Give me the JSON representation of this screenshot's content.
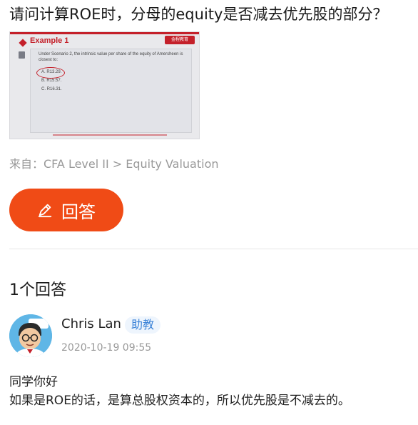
{
  "question": {
    "title": "请问计算ROE时，分母的equity是否减去优先股的部分？"
  },
  "thumbnail": {
    "heading": "Example 1",
    "logo_text": "金程教育",
    "question_text": "Under Scenario 2, the intrinsic value per share of the equity of Amersheen is closest to:",
    "options": [
      "A.  R13.29.",
      "B.  R15.57.",
      "C.  R16.31."
    ]
  },
  "source": {
    "text": "来自：CFA Level II > Equity Valuation"
  },
  "answer_button": {
    "label": "回答"
  },
  "answers": {
    "count_label": "1个回答",
    "items": [
      {
        "author": "Chris Lan",
        "role": "助教",
        "timestamp": "2020-10-19 09:55",
        "lines": [
          "同学你好",
          "如果是ROE的话，是算总股权资本的，所以优先股是不减去的。"
        ]
      }
    ]
  },
  "colors": {
    "accent": "#f04b16",
    "badge_text": "#3d84d8",
    "badge_bg": "#eef5fd",
    "muted": "#999999",
    "slide_red": "#c4202a"
  }
}
